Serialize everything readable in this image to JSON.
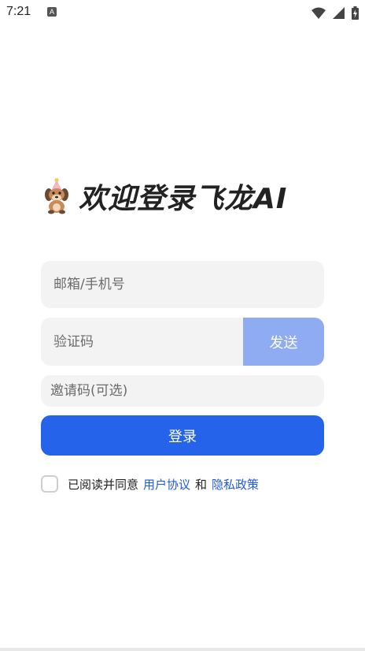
{
  "status_bar": {
    "time": "7:21",
    "a_label": "A",
    "icons": [
      "wifi-icon",
      "cellular-signal-icon",
      "battery-charging-icon"
    ]
  },
  "header": {
    "welcome_title": "欢迎登录飞龙AI",
    "logo_icon": "dog-logo-icon"
  },
  "form": {
    "email_placeholder": "邮箱/手机号",
    "email_value": "",
    "code_placeholder": "验证码",
    "code_value": "",
    "send_label": "发送",
    "invite_placeholder": "邀请码(可选)",
    "invite_value": "",
    "login_label": "登录"
  },
  "agreement": {
    "checked": false,
    "prefix": "已阅读并同意",
    "user_agreement": "用户协议",
    "and": "和",
    "privacy_policy": "隐私政策"
  },
  "colors": {
    "primary": "#2563eb",
    "send_disabled": "#8fabf2",
    "field_bg": "#f3f3f3",
    "link": "#1f5ad9"
  }
}
